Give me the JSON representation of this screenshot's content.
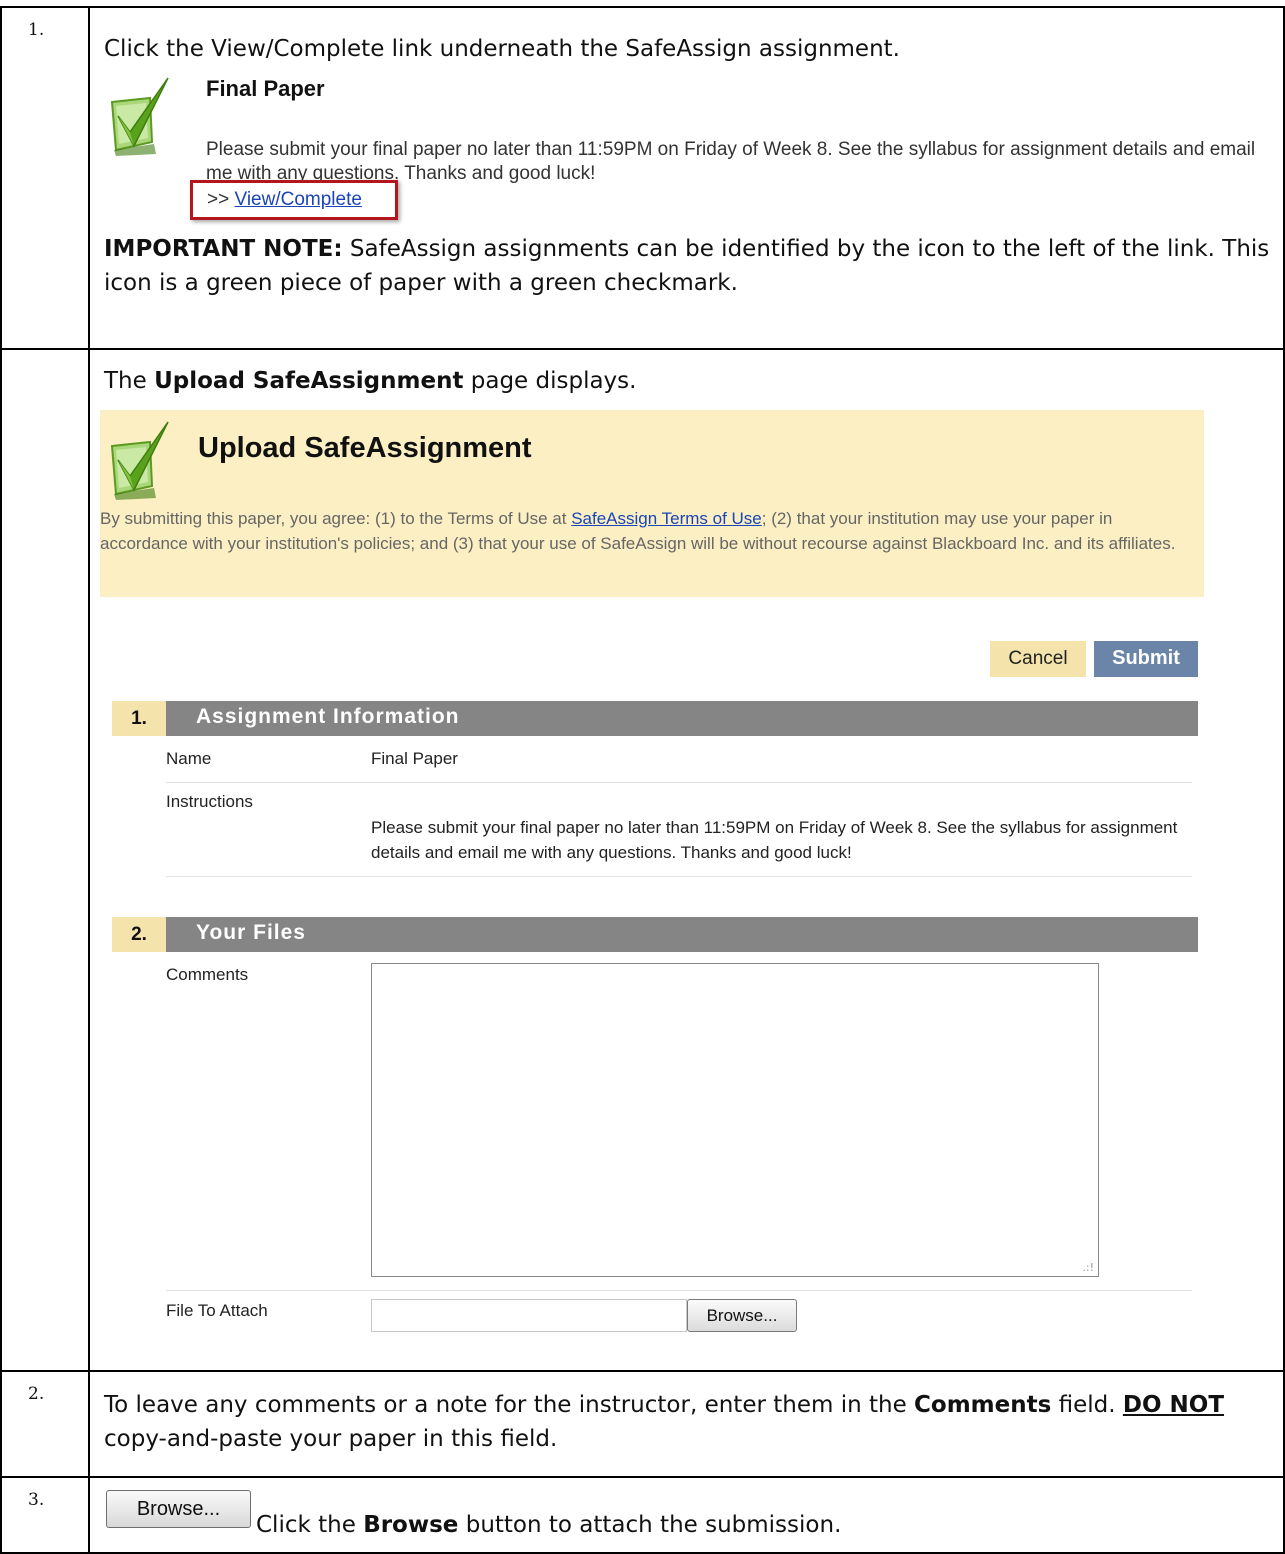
{
  "steps": {
    "s1": {
      "number": "1.",
      "instruction": "Click the View/Complete link underneath the SafeAssign assignment.",
      "item_title": "Final Paper",
      "item_desc": "Please submit your final paper no later than 11:59PM on Friday of Week 8. See the syllabus for assignment details and email me with any questions. Thanks and good luck!",
      "link_prefix": ">> ",
      "link_label": "View/Complete",
      "note_label": "IMPORTANT NOTE:",
      "note_text": " SafeAssign assignments can be identified by the icon to the left of the link. This icon is a green piece of paper with a green checkmark."
    },
    "upload": {
      "number": "",
      "intro_pre": "The ",
      "intro_bold": "Upload SafeAssignment",
      "intro_post": " page displays.",
      "title": "Upload SafeAssignment",
      "terms_pre": "By submitting this paper, you agree: (1) to the Terms of Use at ",
      "terms_link": "SafeAssign Terms of Use",
      "terms_post": "; (2) that your institution may use your paper in accordance with your institution's policies; and (3) that your use of SafeAssign will be without recourse against Blackboard Inc. and its affiliates.",
      "cancel_label": "Cancel",
      "submit_label": "Submit",
      "section1_num": "1.",
      "section1_title": "Assignment Information",
      "name_label": "Name",
      "name_value": "Final Paper",
      "instructions_label": "Instructions",
      "instructions_value": "Please submit your final paper no later than 11:59PM on Friday of Week 8. See the syllabus for assignment details and email me with any questions. Thanks and good luck!",
      "section2_num": "2.",
      "section2_title": "Your Files",
      "comments_label": "Comments",
      "comments_value": "",
      "file_label": "File To Attach",
      "file_value": "",
      "browse_label": "Browse..."
    },
    "s2": {
      "number": "2.",
      "text_pre": "To leave any comments or a note for the instructor, enter them in the ",
      "text_bold": "Comments",
      "text_mid": " field. ",
      "text_warn": "DO NOT",
      "text_post": " copy-and-paste your paper in this field."
    },
    "s3": {
      "number": "3.",
      "browse_label": "Browse...",
      "text_pre": "Click the ",
      "text_bold": "Browse",
      "text_post": " button to attach the submission."
    }
  },
  "colors": {
    "banner": "#fbefc3",
    "section_header": "#858585",
    "submit": "#6b85a9",
    "highlight_box": "#b3161c",
    "icon_green": "#6cae2d"
  }
}
